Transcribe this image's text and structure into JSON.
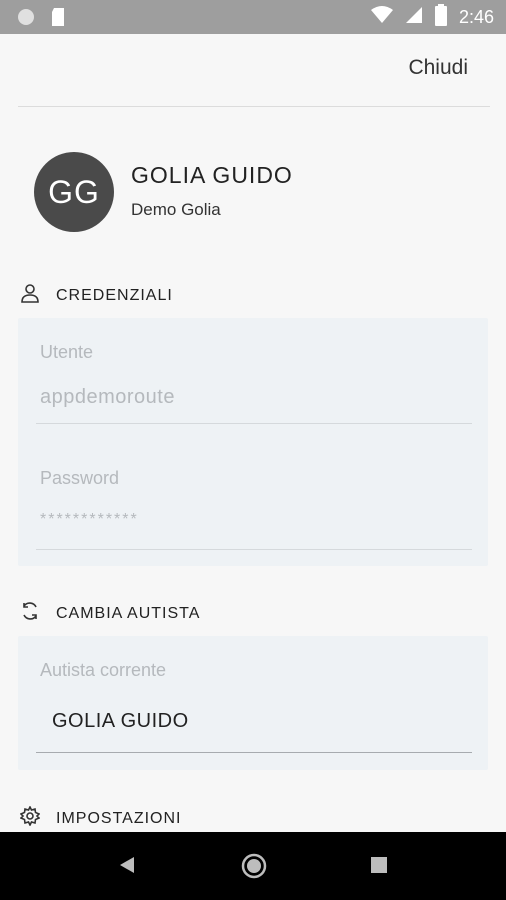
{
  "status_bar": {
    "time": "2:46"
  },
  "header": {
    "close_label": "Chiudi"
  },
  "profile": {
    "initials": "GG",
    "name": "GOLIA GUIDO",
    "company": "Demo Golia"
  },
  "sections": {
    "credentials": {
      "title": "CREDENZIALI",
      "user_label": "Utente",
      "user_value": "appdemoroute",
      "password_label": "Password",
      "password_value": "************"
    },
    "change_driver": {
      "title": "CAMBIA AUTISTA",
      "current_label": "Autista corrente",
      "current_value": "GOLIA GUIDO"
    },
    "settings": {
      "title": "IMPOSTAZIONI"
    }
  }
}
